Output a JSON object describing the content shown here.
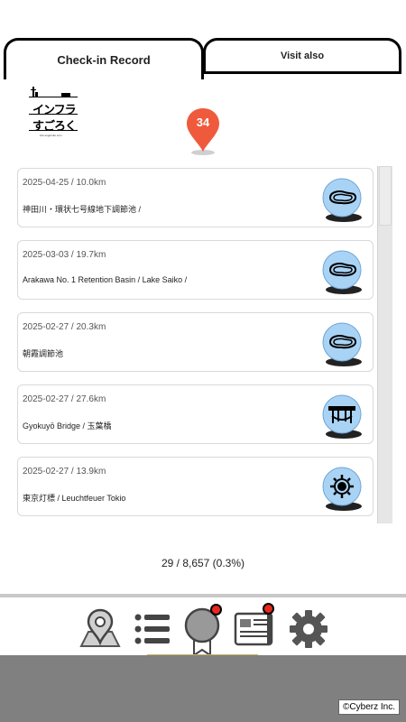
{
  "tabs": [
    {
      "label": "Check-in Record",
      "active": true
    },
    {
      "label": "Visit also",
      "active": false
    }
  ],
  "logo": {
    "line1": "インフラ",
    "line2": "すごろく",
    "url": "info.sugoroku.com"
  },
  "badge": {
    "count": "34",
    "color": "#f05a3c"
  },
  "records": [
    {
      "meta": "2025-04-25 / 10.0km",
      "title": "神田川・環状七号線地下調節池 /",
      "icon": "retention-basin-icon"
    },
    {
      "meta": "2025-03-03 / 19.7km",
      "title": "Arakawa No. 1 Retention Basin / Lake Saiko /",
      "icon": "retention-basin-icon"
    },
    {
      "meta": "2025-02-27 / 20.3km",
      "title": "朝霞調節池",
      "icon": "retention-basin-icon"
    },
    {
      "meta": "2025-02-27 / 27.6km",
      "title": "Gyokuyō Bridge / 玉葉橋",
      "icon": "bridge-icon"
    },
    {
      "meta": "2025-02-27 / 13.9km",
      "title": "東京灯標 / Leuchtfeuer Tokio",
      "icon": "lighthouse-icon"
    }
  ],
  "stats": "29 / 8,657 (0.3%)",
  "nav": [
    {
      "icon": "map-icon"
    },
    {
      "icon": "list-icon"
    },
    {
      "icon": "medal-icon",
      "badge": true,
      "active": true
    },
    {
      "icon": "news-icon",
      "badge": true
    },
    {
      "icon": "settings-icon"
    }
  ],
  "copyright": "©Cyberz Inc.",
  "colors": {
    "icon_bg": "#a9d3f5",
    "badge_red": "#e8281e",
    "accent_underline": "#c9b36a"
  }
}
